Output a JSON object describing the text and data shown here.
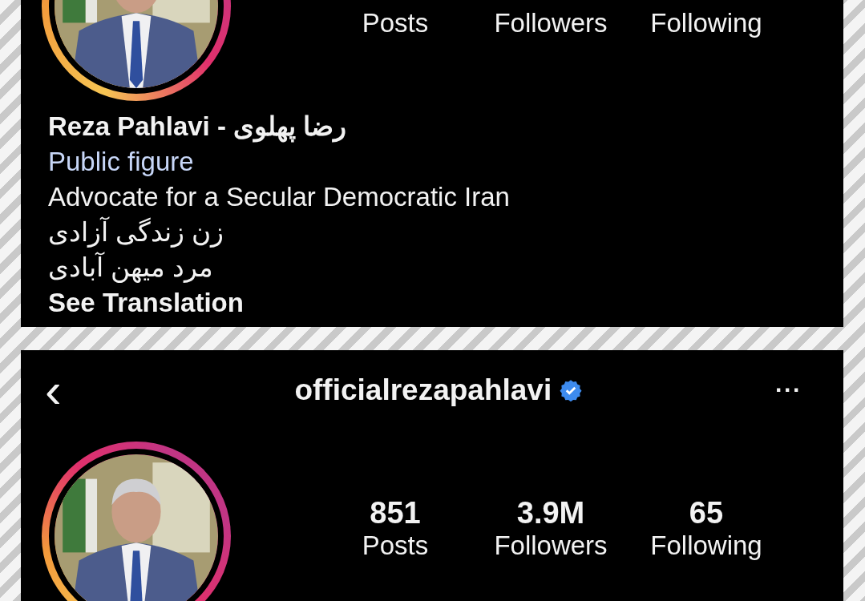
{
  "top_panel": {
    "avatar": {
      "kind": "picture",
      "story_ring": true
    },
    "stats": [
      {
        "label": "Posts"
      },
      {
        "label": "Followers"
      },
      {
        "label": "Following"
      }
    ],
    "name": "Reza Pahlavi - رضا پهلوی",
    "category": "Public figure",
    "bio": [
      "Advocate for a Secular Democratic Iran",
      "زن زندگی آزادی",
      "مرد میهن آبادی"
    ],
    "see_translation": "See Translation"
  },
  "bottom_panel": {
    "header": {
      "back": "‹",
      "username": "officialrezapahlavi",
      "verified": true,
      "more": "···"
    },
    "avatar": {
      "kind": "picture",
      "story_ring": true
    },
    "stats": [
      {
        "value": "851",
        "label": "Posts"
      },
      {
        "value": "3.9M",
        "label": "Followers"
      },
      {
        "value": "65",
        "label": "Following"
      }
    ]
  }
}
